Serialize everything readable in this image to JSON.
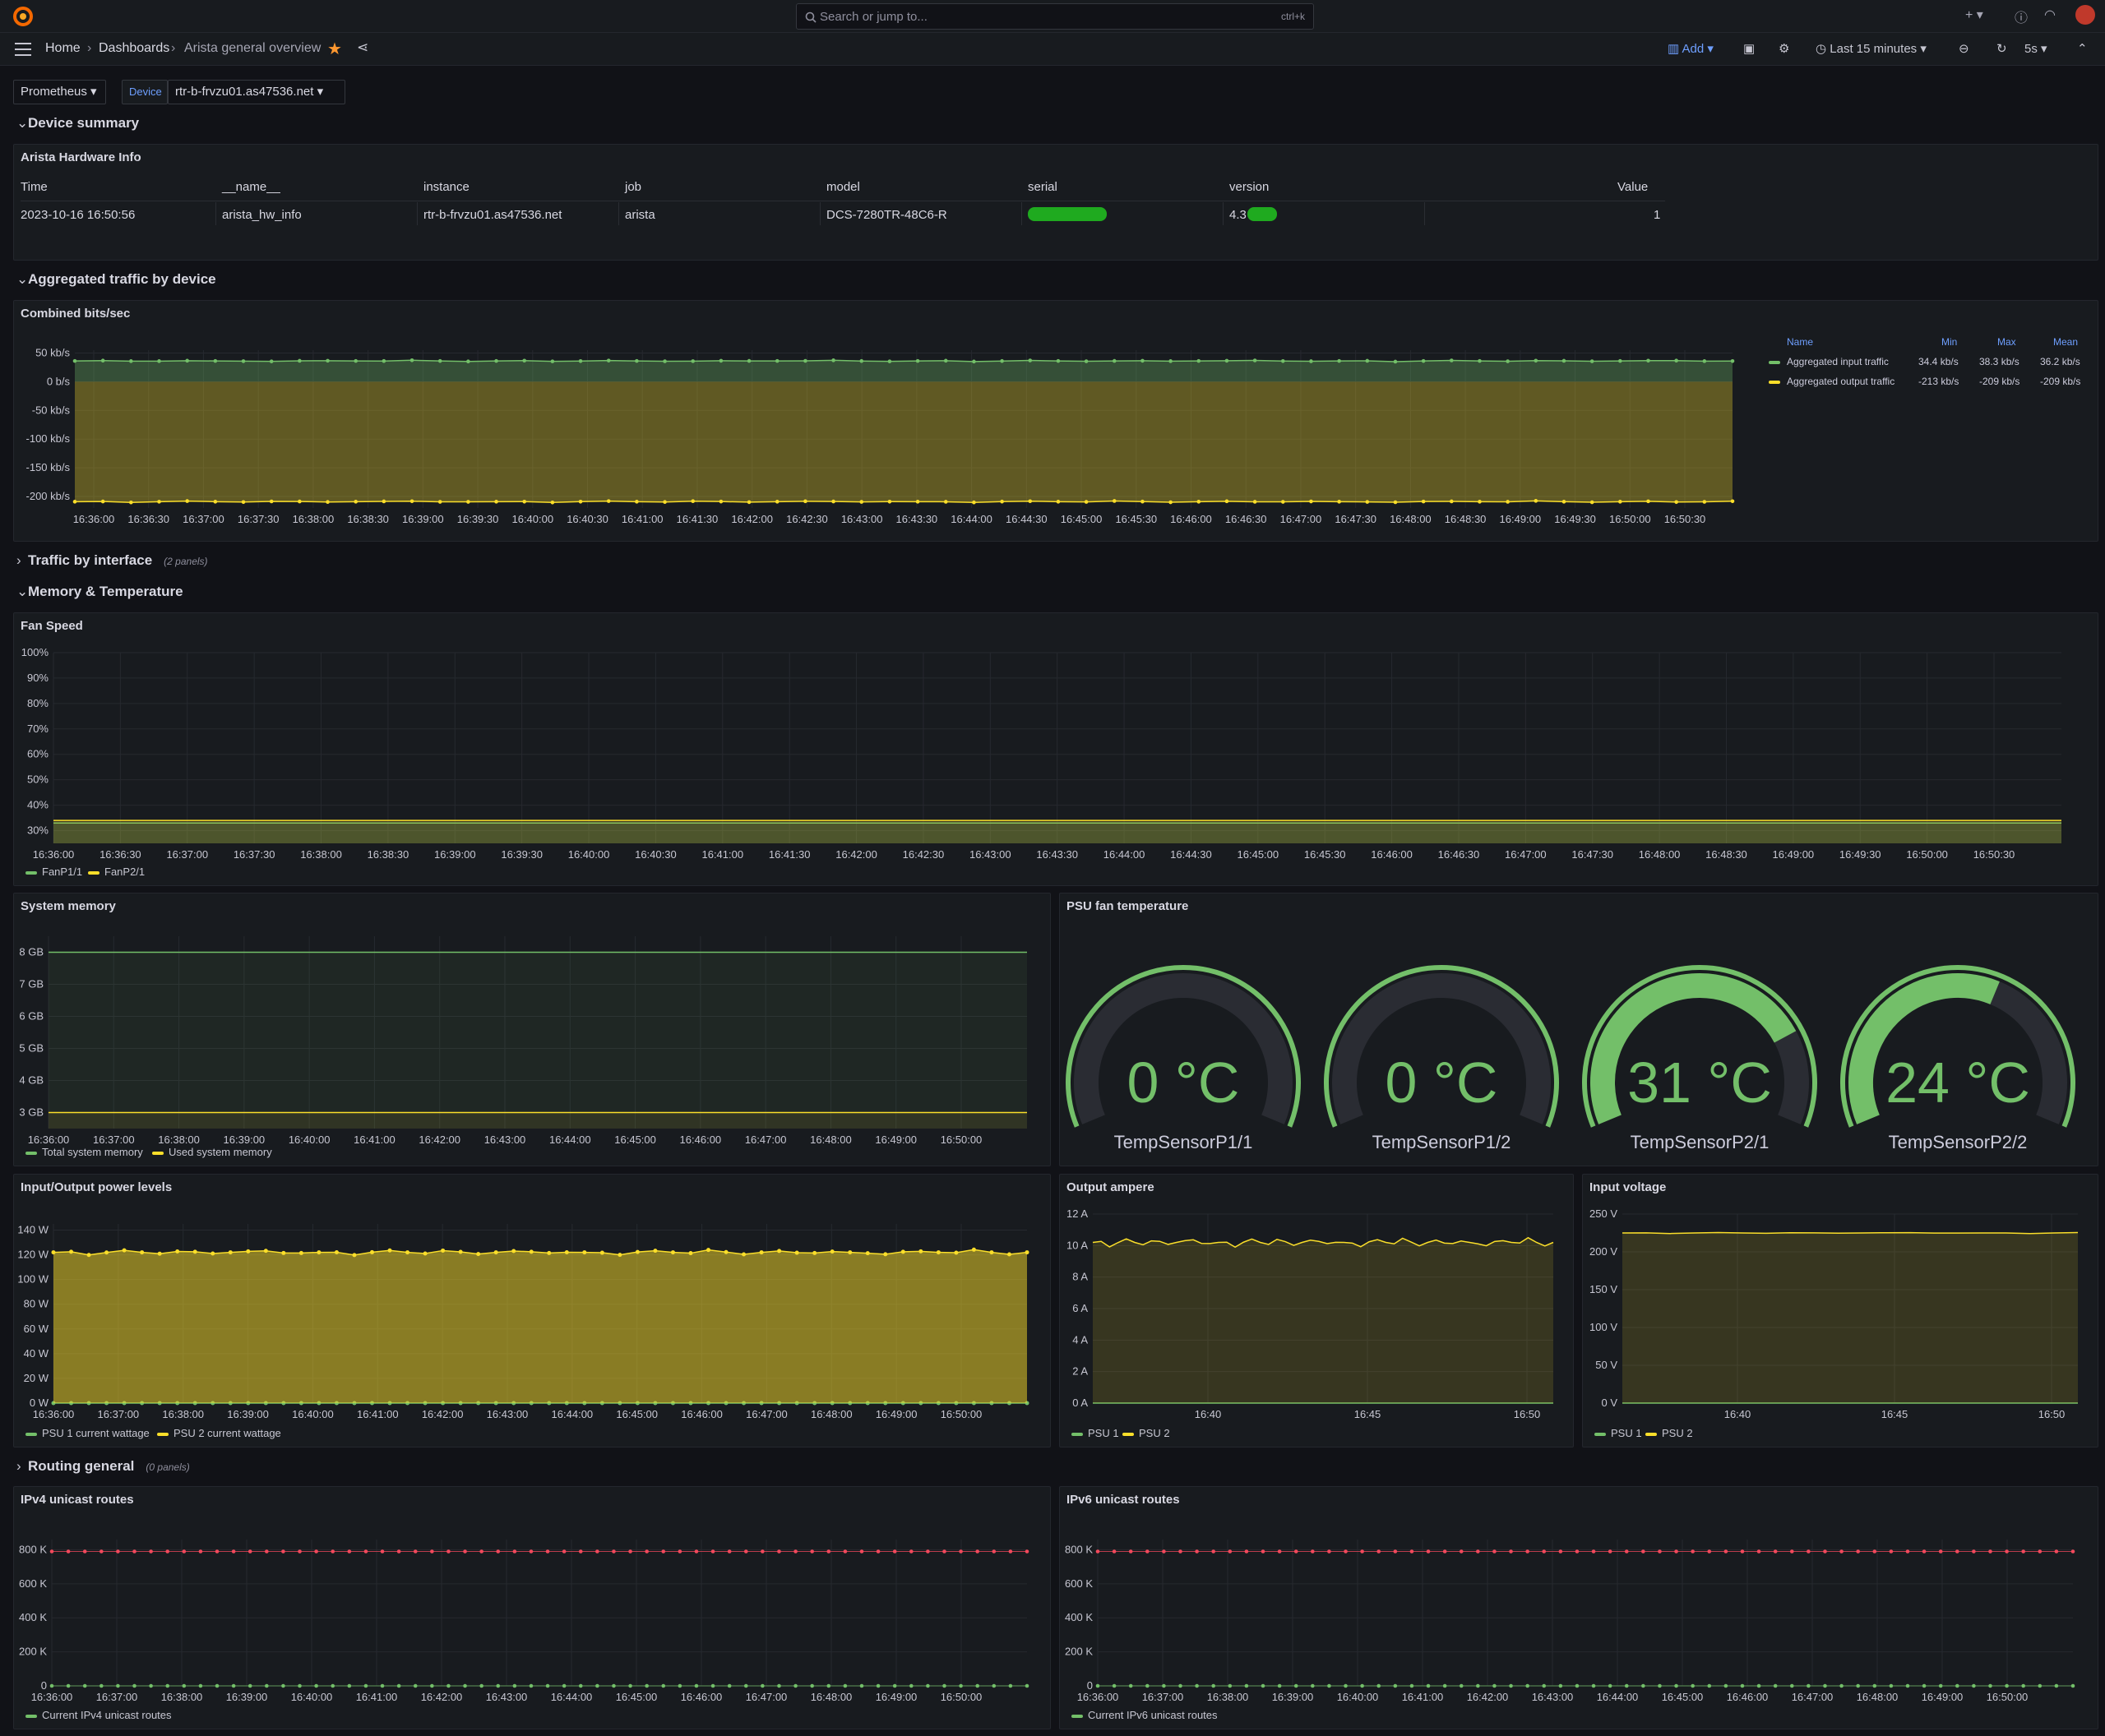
{
  "topbar": {
    "search_placeholder": "Search or jump to...",
    "search_shortcut": "ctrl+k"
  },
  "breadcrumb": {
    "home": "Home",
    "dashboards": "Dashboards",
    "current": "Arista general overview"
  },
  "toolbar": {
    "add_label": "Add",
    "time_range": "Last 15 minutes",
    "refresh_interval": "5s"
  },
  "variables": {
    "datasource": "Prometheus",
    "device_label": "Device",
    "device_value": "rtr-b-frvzu01.as47536.net"
  },
  "rows": {
    "device_summary": "Device summary",
    "aggregated": "Aggregated traffic by device",
    "traffic_if": "Traffic by interface",
    "traffic_if_count": "(2 panels)",
    "memtemp": "Memory & Temperature",
    "routing": "Routing general",
    "routing_count": "(0 panels)"
  },
  "hwinfo": {
    "title": "Arista Hardware Info",
    "columns": [
      "Time",
      "__name__",
      "instance",
      "job",
      "model",
      "serial",
      "version",
      "Value"
    ],
    "row": [
      "2023-10-16 16:50:56",
      "arista_hw_info",
      "rtr-b-frvzu01.as47536.net",
      "arista",
      "DCS-7280TR-48C6-R",
      "",
      "4.3",
      "1"
    ]
  },
  "traffic_panel": {
    "title": "Combined bits/sec",
    "legend_headers": [
      "Name",
      "Min",
      "Max",
      "Mean"
    ],
    "legend_rows": [
      {
        "name": "Aggregated input traffic",
        "min": "34.4 kb/s",
        "max": "38.3 kb/s",
        "mean": "36.2 kb/s",
        "color": "#73bf69"
      },
      {
        "name": "Aggregated output traffic",
        "min": "-213 kb/s",
        "max": "-209 kb/s",
        "mean": "-209 kb/s",
        "color": "#fade2a"
      }
    ]
  },
  "fan_panel": {
    "title": "Fan Speed",
    "legend": [
      "FanP1/1",
      "FanP2/1"
    ]
  },
  "memory_panel": {
    "title": "System memory",
    "legend": [
      "Total system memory",
      "Used system memory"
    ]
  },
  "psu_panel": {
    "title": "PSU fan temperature",
    "gauges": [
      {
        "value_label": "0 °C",
        "value": 0,
        "name": "TempSensorP1/1"
      },
      {
        "value_label": "0 °C",
        "value": 0,
        "name": "TempSensorP1/2"
      },
      {
        "value_label": "31 °C",
        "value": 31,
        "name": "TempSensorP2/1"
      },
      {
        "value_label": "24 °C",
        "value": 24,
        "name": "TempSensorP2/2"
      }
    ]
  },
  "power_panel": {
    "title": "Input/Output power levels",
    "legend": [
      "PSU 1 current wattage",
      "PSU 2 current wattage"
    ]
  },
  "ampere_panel": {
    "title": "Output ampere",
    "legend": [
      "PSU 1",
      "PSU 2"
    ]
  },
  "voltage_panel": {
    "title": "Input voltage",
    "legend": [
      "PSU 1",
      "PSU 2"
    ]
  },
  "ipv4_panel": {
    "title": "IPv4 unicast routes",
    "legend": [
      "Current IPv4 unicast routes"
    ]
  },
  "ipv6_panel": {
    "title": "IPv6 unicast routes",
    "legend": [
      "Current IPv6 unicast routes"
    ]
  },
  "colors": {
    "green": "#73bf69",
    "yellow": "#fade2a",
    "red": "#f2495c",
    "accent": "#6e9fff"
  },
  "chart_data": [
    {
      "id": "traffic",
      "type": "area",
      "title": "Combined bits/sec",
      "x": [
        "16:36:00",
        "16:36:30",
        "16:37:00",
        "16:37:30",
        "16:38:00",
        "16:38:30",
        "16:39:00",
        "16:39:30",
        "16:40:00",
        "16:40:30",
        "16:41:00",
        "16:41:30",
        "16:42:00",
        "16:42:30",
        "16:43:00",
        "16:43:30",
        "16:44:00",
        "16:44:30",
        "16:45:00",
        "16:45:30",
        "16:46:00",
        "16:46:30",
        "16:47:00",
        "16:47:30",
        "16:48:00",
        "16:48:30",
        "16:49:00",
        "16:49:30",
        "16:50:00",
        "16:50:30"
      ],
      "y_ticks": [
        "50 kb/s",
        "0 b/s",
        "-50 kb/s",
        "-100 kb/s",
        "-150 kb/s",
        "-200 kb/s"
      ],
      "ylim": [
        -220,
        55
      ],
      "series": [
        {
          "name": "Aggregated input traffic",
          "approx_value": 36.2
        },
        {
          "name": "Aggregated output traffic",
          "approx_value": -209
        }
      ]
    },
    {
      "id": "fan",
      "type": "area",
      "title": "Fan Speed",
      "x": [
        "16:36:00",
        "16:36:30",
        "16:37:00",
        "16:37:30",
        "16:38:00",
        "16:38:30",
        "16:39:00",
        "16:39:30",
        "16:40:00",
        "16:40:30",
        "16:41:00",
        "16:41:30",
        "16:42:00",
        "16:42:30",
        "16:43:00",
        "16:43:30",
        "16:44:00",
        "16:44:30",
        "16:45:00",
        "16:45:30",
        "16:46:00",
        "16:46:30",
        "16:47:00",
        "16:47:30",
        "16:48:00",
        "16:48:30",
        "16:49:00",
        "16:49:30",
        "16:50:00",
        "16:50:30"
      ],
      "y_ticks": [
        "100%",
        "90%",
        "80%",
        "70%",
        "60%",
        "50%",
        "40%",
        "30%"
      ],
      "ylim": [
        25,
        100
      ],
      "series": [
        {
          "name": "FanP1/1",
          "approx_value": 33
        },
        {
          "name": "FanP2/1",
          "approx_value": 34
        }
      ]
    },
    {
      "id": "memory",
      "type": "area",
      "title": "System memory",
      "x": [
        "16:36:00",
        "16:37:00",
        "16:38:00",
        "16:39:00",
        "16:40:00",
        "16:41:00",
        "16:42:00",
        "16:43:00",
        "16:44:00",
        "16:45:00",
        "16:46:00",
        "16:47:00",
        "16:48:00",
        "16:49:00",
        "16:50:00"
      ],
      "y_ticks": [
        "8 GB",
        "7 GB",
        "6 GB",
        "5 GB",
        "4 GB",
        "3 GB"
      ],
      "ylim": [
        2.5,
        8.5
      ],
      "series": [
        {
          "name": "Total system memory",
          "approx_value": 8
        },
        {
          "name": "Used system memory",
          "approx_value": 3
        }
      ]
    },
    {
      "id": "power",
      "type": "area",
      "title": "Input/Output power levels",
      "x": [
        "16:36:00",
        "16:37:00",
        "16:38:00",
        "16:39:00",
        "16:40:00",
        "16:41:00",
        "16:42:00",
        "16:43:00",
        "16:44:00",
        "16:45:00",
        "16:46:00",
        "16:47:00",
        "16:48:00",
        "16:49:00",
        "16:50:00"
      ],
      "y_ticks": [
        "140 W",
        "120 W",
        "100 W",
        "80 W",
        "60 W",
        "40 W",
        "20 W",
        "0 W"
      ],
      "ylim": [
        0,
        145
      ],
      "series": [
        {
          "name": "PSU 1 current wattage",
          "approx_value": 0
        },
        {
          "name": "PSU 2 current wattage",
          "approx_value": 122
        }
      ]
    },
    {
      "id": "ampere",
      "type": "area",
      "title": "Output ampere",
      "x": [
        "16:40",
        "16:45",
        "16:50"
      ],
      "y_ticks": [
        "12 A",
        "10 A",
        "8 A",
        "6 A",
        "4 A",
        "2 A",
        "0 A"
      ],
      "ylim": [
        0,
        12
      ],
      "series": [
        {
          "name": "PSU 1",
          "approx_value": 0
        },
        {
          "name": "PSU 2",
          "approx_value": 10.2
        }
      ]
    },
    {
      "id": "voltage",
      "type": "area",
      "title": "Input voltage",
      "x": [
        "16:40",
        "16:45",
        "16:50"
      ],
      "y_ticks": [
        "250 V",
        "200 V",
        "150 V",
        "100 V",
        "50 V",
        "0 V"
      ],
      "ylim": [
        0,
        250
      ],
      "series": [
        {
          "name": "PSU 1",
          "approx_value": 0
        },
        {
          "name": "PSU 2",
          "approx_value": 225
        }
      ]
    },
    {
      "id": "ipv4",
      "type": "line",
      "title": "IPv4 unicast routes",
      "x": [
        "16:36:00",
        "16:37:00",
        "16:38:00",
        "16:39:00",
        "16:40:00",
        "16:41:00",
        "16:42:00",
        "16:43:00",
        "16:44:00",
        "16:45:00",
        "16:46:00",
        "16:47:00",
        "16:48:00",
        "16:49:00",
        "16:50:00"
      ],
      "y_ticks": [
        "800 K",
        "600 K",
        "400 K",
        "200 K",
        "0"
      ],
      "ylim": [
        0,
        860
      ],
      "series": [
        {
          "name": "Current IPv4 unicast routes",
          "approx_value": 0
        },
        {
          "name": "",
          "approx_value": 790
        }
      ]
    },
    {
      "id": "ipv6",
      "type": "line",
      "title": "IPv6 unicast routes",
      "x": [
        "16:36:00",
        "16:37:00",
        "16:38:00",
        "16:39:00",
        "16:40:00",
        "16:41:00",
        "16:42:00",
        "16:43:00",
        "16:44:00",
        "16:45:00",
        "16:46:00",
        "16:47:00",
        "16:48:00",
        "16:49:00",
        "16:50:00"
      ],
      "y_ticks": [
        "800 K",
        "600 K",
        "400 K",
        "200 K",
        "0"
      ],
      "ylim": [
        0,
        860
      ],
      "series": [
        {
          "name": "Current IPv6 unicast routes",
          "approx_value": 0
        },
        {
          "name": "",
          "approx_value": 790
        }
      ]
    }
  ]
}
